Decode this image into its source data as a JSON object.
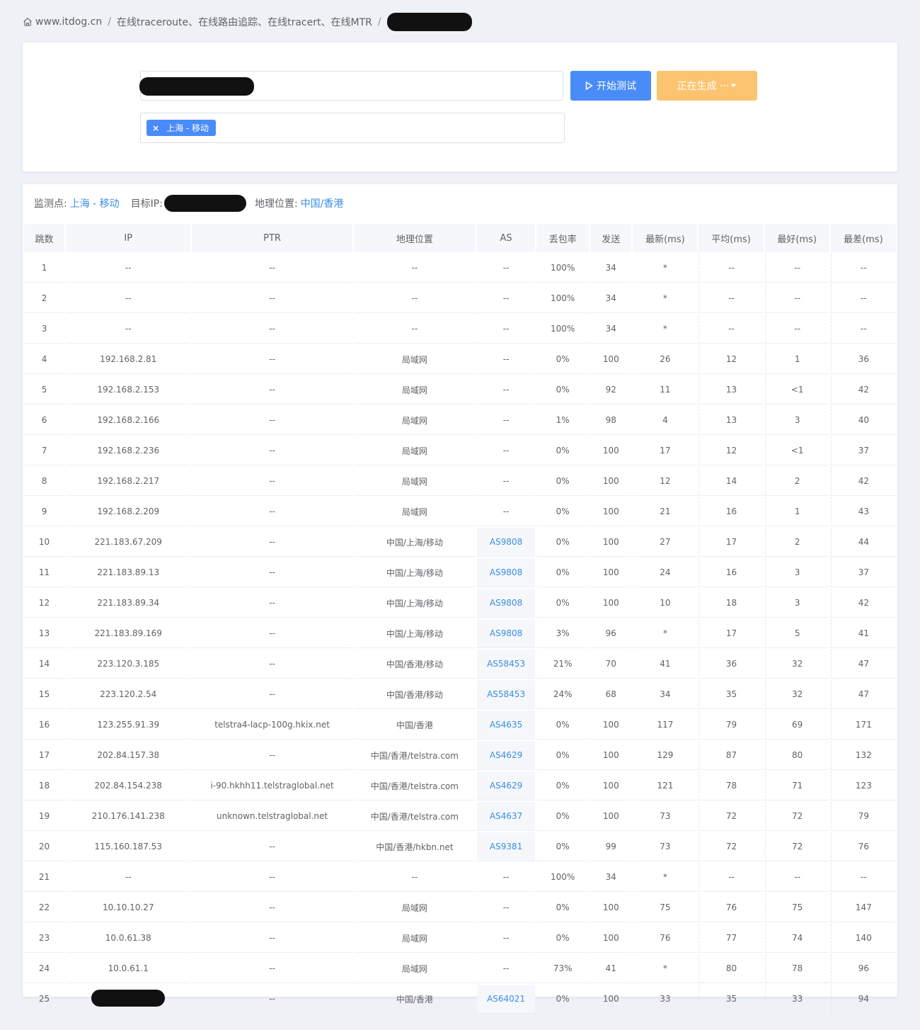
{
  "breadcrumb": {
    "home": "www.itdog.cn",
    "current": "在线traceroute、在线路由追踪、在线tracert、在线MTR"
  },
  "form": {
    "start_label": "开始测试",
    "generating_label": "正在生成 ··· ",
    "node_tag": "上海 - 移动"
  },
  "info": {
    "node_label": "监测点:",
    "node_value": "上海 - 移动",
    "target_label": "目标IP:",
    "geo_label": "地理位置:",
    "geo_value": "中国/香港"
  },
  "colors": {
    "primary": "#4a8cf7",
    "warning": "#fcc470",
    "link": "#3a8ee6"
  },
  "table": {
    "headers": [
      "跳数",
      "IP",
      "PTR",
      "地理位置",
      "AS",
      "丢包率",
      "发送",
      "最新(ms)",
      "平均(ms)",
      "最好(ms)",
      "最差(ms)"
    ],
    "rows": [
      [
        "1",
        "--",
        "--",
        "--",
        "--",
        "100%",
        "34",
        "*",
        "--",
        "--",
        "--"
      ],
      [
        "2",
        "--",
        "--",
        "--",
        "--",
        "100%",
        "34",
        "*",
        "--",
        "--",
        "--"
      ],
      [
        "3",
        "--",
        "--",
        "--",
        "--",
        "100%",
        "34",
        "*",
        "--",
        "--",
        "--"
      ],
      [
        "4",
        "192.168.2.81",
        "--",
        "局域网",
        "--",
        "0%",
        "100",
        "26",
        "12",
        "1",
        "36"
      ],
      [
        "5",
        "192.168.2.153",
        "--",
        "局域网",
        "--",
        "0%",
        "92",
        "11",
        "13",
        "<1",
        "42"
      ],
      [
        "6",
        "192.168.2.166",
        "--",
        "局域网",
        "--",
        "1%",
        "98",
        "4",
        "13",
        "3",
        "40"
      ],
      [
        "7",
        "192.168.2.236",
        "--",
        "局域网",
        "--",
        "0%",
        "100",
        "17",
        "12",
        "<1",
        "37"
      ],
      [
        "8",
        "192.168.2.217",
        "--",
        "局域网",
        "--",
        "0%",
        "100",
        "12",
        "14",
        "2",
        "42"
      ],
      [
        "9",
        "192.168.2.209",
        "--",
        "局域网",
        "--",
        "0%",
        "100",
        "21",
        "16",
        "1",
        "43"
      ],
      [
        "10",
        "221.183.67.209",
        "--",
        "中国/上海/移动",
        "AS9808",
        "0%",
        "100",
        "27",
        "17",
        "2",
        "44"
      ],
      [
        "11",
        "221.183.89.13",
        "--",
        "中国/上海/移动",
        "AS9808",
        "0%",
        "100",
        "24",
        "16",
        "3",
        "37"
      ],
      [
        "12",
        "221.183.89.34",
        "--",
        "中国/上海/移动",
        "AS9808",
        "0%",
        "100",
        "10",
        "18",
        "3",
        "42"
      ],
      [
        "13",
        "221.183.89.169",
        "--",
        "中国/上海/移动",
        "AS9808",
        "3%",
        "96",
        "*",
        "17",
        "5",
        "41"
      ],
      [
        "14",
        "223.120.3.185",
        "--",
        "中国/香港/移动",
        "AS58453",
        "21%",
        "70",
        "41",
        "36",
        "32",
        "47"
      ],
      [
        "15",
        "223.120.2.54",
        "--",
        "中国/香港/移动",
        "AS58453",
        "24%",
        "68",
        "34",
        "35",
        "32",
        "47"
      ],
      [
        "16",
        "123.255.91.39",
        "telstra4-lacp-100g.hkix.net",
        "中国/香港",
        "AS4635",
        "0%",
        "100",
        "117",
        "79",
        "69",
        "171"
      ],
      [
        "17",
        "202.84.157.38",
        "--",
        "中国/香港/telstra.com",
        "AS4629",
        "0%",
        "100",
        "129",
        "87",
        "80",
        "132"
      ],
      [
        "18",
        "202.84.154.238",
        "i-90.hkhh11.telstraglobal.net",
        "中国/香港/telstra.com",
        "AS4629",
        "0%",
        "100",
        "121",
        "78",
        "71",
        "123"
      ],
      [
        "19",
        "210.176.141.238",
        "unknown.telstraglobal.net",
        "中国/香港/telstra.com",
        "AS4637",
        "0%",
        "100",
        "73",
        "72",
        "72",
        "79"
      ],
      [
        "20",
        "115.160.187.53",
        "--",
        "中国/香港/hkbn.net",
        "AS9381",
        "0%",
        "99",
        "73",
        "72",
        "72",
        "76"
      ],
      [
        "21",
        "--",
        "--",
        "--",
        "--",
        "100%",
        "34",
        "*",
        "--",
        "--",
        "--"
      ],
      [
        "22",
        "10.10.10.27",
        "--",
        "局域网",
        "--",
        "0%",
        "100",
        "75",
        "76",
        "75",
        "147"
      ],
      [
        "23",
        "10.0.61.38",
        "--",
        "局域网",
        "--",
        "0%",
        "100",
        "76",
        "77",
        "74",
        "140"
      ],
      [
        "24",
        "10.0.61.1",
        "--",
        "局域网",
        "--",
        "73%",
        "41",
        "*",
        "80",
        "78",
        "96"
      ],
      [
        "25",
        "",
        "--",
        "中国/香港",
        "AS64021",
        "0%",
        "100",
        "33",
        "35",
        "33",
        "94"
      ]
    ]
  }
}
